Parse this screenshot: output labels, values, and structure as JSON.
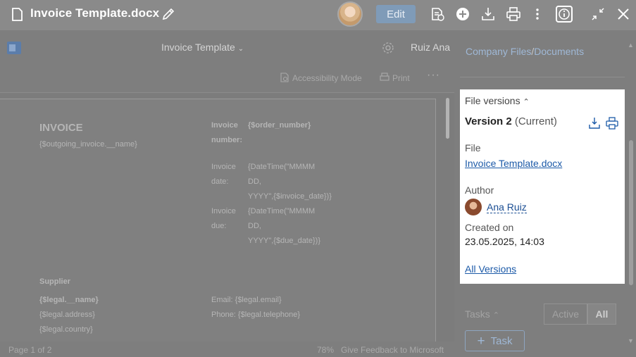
{
  "topbar": {
    "title": "Invoice Template.docx",
    "edit_label": "Edit"
  },
  "word": {
    "doc_title": "Invoice Template",
    "user_name": "Ruiz Ana",
    "accessibility_label": "Accessibility Mode",
    "print_label": "Print",
    "more_label": "···",
    "status_page": "Page 1 of 2",
    "status_zoom": "78%",
    "status_feedback": "Give Feedback to Microsoft"
  },
  "document": {
    "heading": "INVOICE",
    "outgoing": "{$outgoing_invoice.__name}",
    "invoice_number_label_1": "Invoice",
    "invoice_number_label_2": "number:",
    "invoice_number_value": "{$order_number}",
    "invoice_date_label_1": "Invoice",
    "invoice_date_label_2": "date:",
    "invoice_date_value_1": "{DateTime(\"MMMM",
    "invoice_date_value_2": "DD,",
    "invoice_date_value_3": "YYYY\",{$invoice_date})}",
    "invoice_due_label_1": "Invoice",
    "invoice_due_label_2": "due:",
    "invoice_due_value_1": "{DateTime(\"MMMM",
    "invoice_due_value_2": "DD,",
    "invoice_due_value_3": "YYYY\",{$due_date})}",
    "supplier_label": "Supplier",
    "legal_name": "{$legal.__name}",
    "legal_address": "{$legal.address}",
    "legal_country": "{$legal.country}",
    "email_line": "Email: {$legal.email}",
    "phone_line": "Phone: {$legal.telephone}"
  },
  "side": {
    "breadcrumb_a": "Company Files",
    "breadcrumb_sep": "/",
    "breadcrumb_b": "Documents",
    "versions_heading": "File versions",
    "version_name": "Version 2",
    "version_status": "(Current)",
    "file_label": "File",
    "file_link": "Invoice Template.docx",
    "author_label": "Author",
    "author_name": "Ana Ruiz",
    "created_label": "Created on",
    "created_value": "23.05.2025, 14:03",
    "all_versions": "All Versions",
    "tasks_label": "Tasks",
    "filter_active": "Active",
    "filter_all": "All",
    "task_button": "Task"
  },
  "colors": {
    "accent_link": "#1c5aa8",
    "overlay": "#7e7e7e",
    "edit_button": "#7f9bb8"
  },
  "icons": [
    "document-icon",
    "pencil-icon",
    "avatar",
    "comment-icon",
    "plus-icon",
    "download-icon",
    "print-icon",
    "more-icon",
    "info-icon",
    "collapse-icon",
    "close-icon",
    "gear-icon",
    "chevron-down-icon",
    "chevron-up-icon"
  ]
}
